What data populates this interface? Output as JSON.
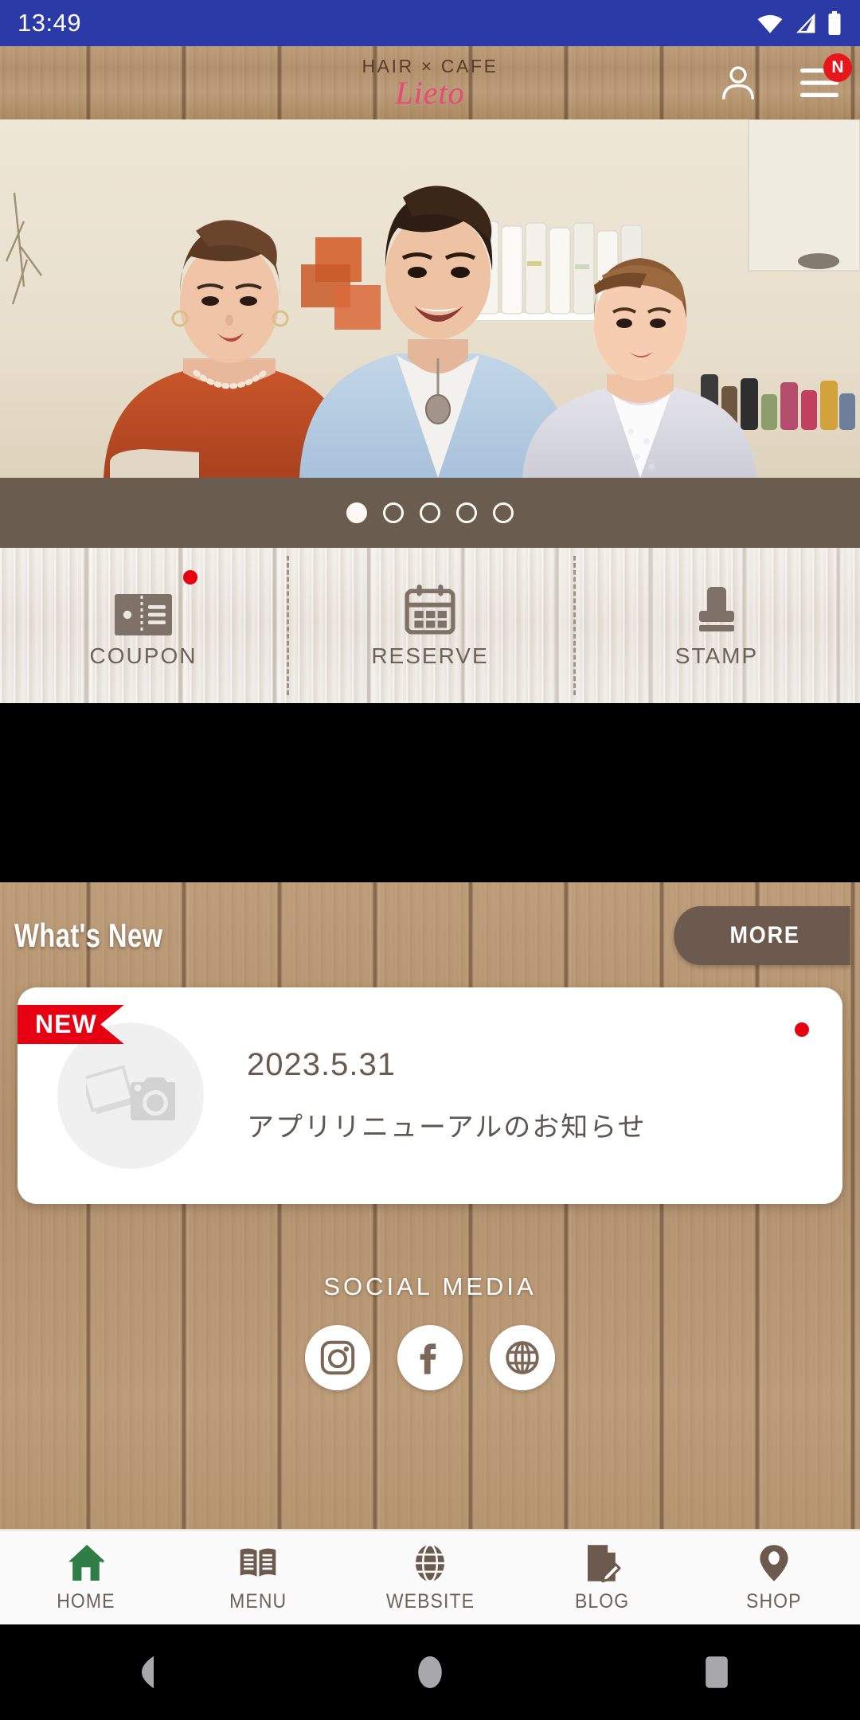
{
  "status_bar": {
    "time": "13:49",
    "icons": [
      "wifi-icon",
      "signal-icon",
      "battery-icon"
    ],
    "background_color": "#2C3AA8"
  },
  "header": {
    "logo_top": "HAIR × CAFE",
    "logo_main": "Lieto",
    "logo_main_color": "#E8487A",
    "logo_top_color": "#5A3D28",
    "account_icon": "person-icon",
    "menu_icon": "hamburger-menu-icon",
    "menu_badge": "N",
    "menu_badge_color": "#E8161C"
  },
  "hero": {
    "alt": "three salon staff members standing in the salon",
    "carousel": {
      "total_dots": 5,
      "active_index": 0
    }
  },
  "quick_actions": [
    {
      "label": "COUPON",
      "icon": "coupon-ticket-icon",
      "badge": true
    },
    {
      "label": "RESERVE",
      "icon": "calendar-icon",
      "badge": false
    },
    {
      "label": "STAMP",
      "icon": "stamp-icon",
      "badge": false
    }
  ],
  "whats_new": {
    "title": "What's New",
    "more_label": "MORE",
    "more_color": "#6B5A4D",
    "card": {
      "ribbon": "NEW",
      "ribbon_color": "#E60012",
      "date": "2023.5.31",
      "text": "アプリリニューアルのお知らせ",
      "thumb_icon": "photo-camera-placeholder-icon",
      "unread_dot": true
    }
  },
  "social": {
    "title": "SOCIAL MEDIA",
    "items": [
      {
        "name": "instagram-icon",
        "label": "Instagram"
      },
      {
        "name": "facebook-icon",
        "label": "Facebook"
      },
      {
        "name": "website-globe-icon",
        "label": "Website"
      }
    ]
  },
  "bottom_nav": {
    "active": "HOME",
    "items": [
      {
        "label": "HOME",
        "icon": "home-icon",
        "color": "#2E7D46"
      },
      {
        "label": "MENU",
        "icon": "book-icon",
        "color": "#6B5A4D"
      },
      {
        "label": "WEBSITE",
        "icon": "globe-icon",
        "color": "#6B5A4D"
      },
      {
        "label": "BLOG",
        "icon": "pencil-document-icon",
        "color": "#6B5A4D"
      },
      {
        "label": "SHOP",
        "icon": "map-pin-icon",
        "color": "#6B5A4D"
      }
    ]
  },
  "android_nav": {
    "back": "back-triangle-icon",
    "home": "home-circle-icon",
    "recents": "recents-square-icon"
  }
}
